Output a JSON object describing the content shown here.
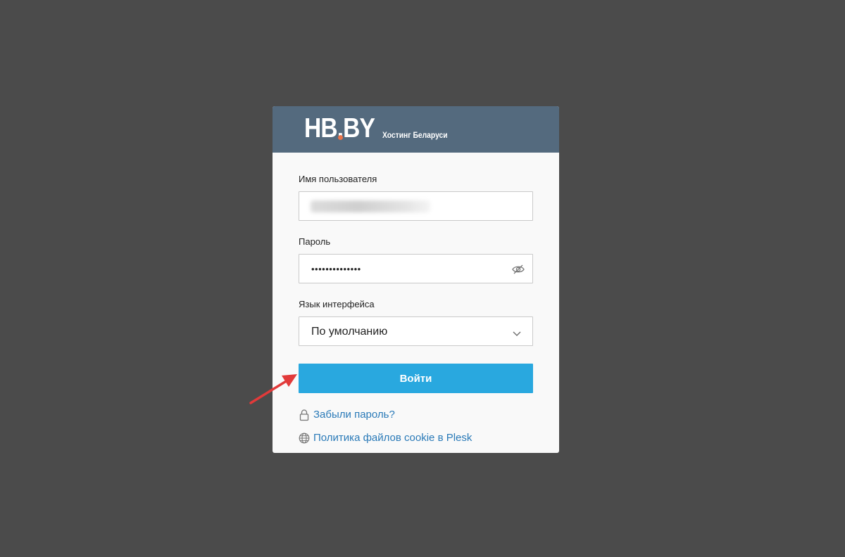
{
  "header": {
    "logo_text": "HB.BY",
    "tagline": "Хостинг Беларуси",
    "accent_color": "#e8734a",
    "background_color": "#546a7e"
  },
  "form": {
    "username_label": "Имя пользователя",
    "password_label": "Пароль",
    "password_value": "••••••••••••••",
    "language_label": "Язык интерфейса",
    "language_value": "По умолчанию",
    "submit_label": "Войти"
  },
  "links": {
    "forgot_password": "Забыли пароль?",
    "cookie_policy": "Политика файлов cookie в Plesk"
  },
  "colors": {
    "page_background": "#4b4b4b",
    "button": "#29a8df",
    "link": "#2a7ab8",
    "annotation_arrow": "#e23a3a"
  },
  "icons": {
    "password_toggle": "eye-slash-icon",
    "select_arrow": "chevron-down-icon",
    "forgot_password": "lock-icon",
    "cookie_policy": "globe-icon",
    "annotation": "red-arrow-icon"
  }
}
